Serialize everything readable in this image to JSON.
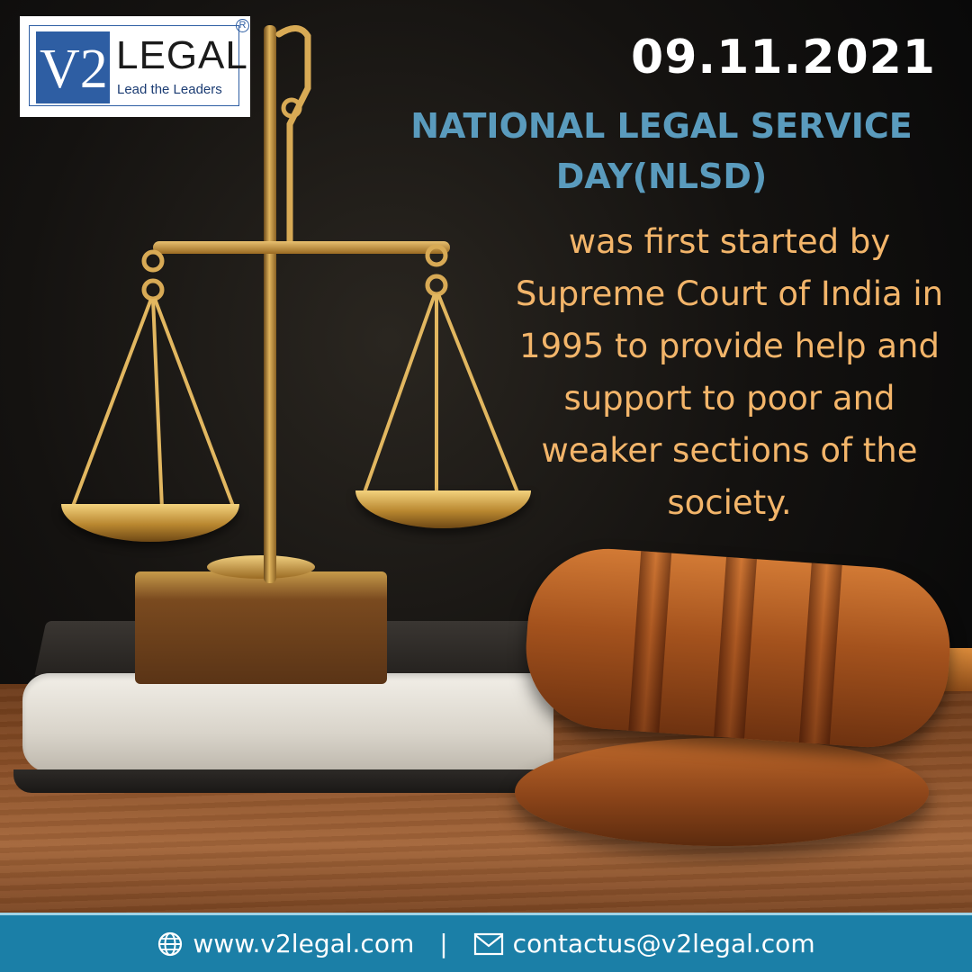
{
  "logo": {
    "mark": "V2",
    "word": "LEGAL",
    "tagline": "Lead the Leaders",
    "registered": "R"
  },
  "date": "09.11.2021",
  "headline": {
    "line1": "NATIONAL LEGAL SERVICE",
    "line2": "DAY(NLSD)"
  },
  "body": {
    "lines": [
      "was first started by",
      "Supreme Court of India in",
      "1995 to provide help and",
      "support to poor and",
      "weaker sections of the",
      "society."
    ]
  },
  "footer": {
    "website": "www.v2legal.com",
    "separator": "|",
    "email": "contactus@v2legal.com",
    "website_icon": "globe-icon",
    "email_icon": "envelope-icon"
  },
  "colors": {
    "headline": "#5a9bbd",
    "body": "#f3b56a",
    "date": "#ffffff",
    "footer_bg": "#1b7fa7",
    "logo_blue": "#2e5ea3"
  }
}
